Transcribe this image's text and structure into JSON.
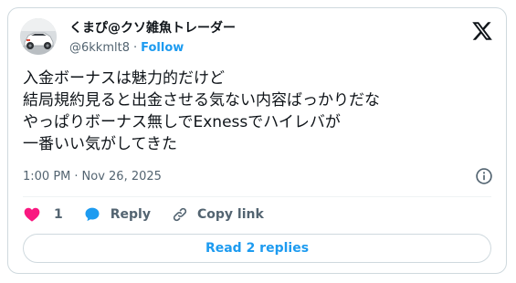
{
  "author": {
    "display_name": "くまぴ@クソ雑魚トレーダー",
    "handle": "@6kkmlt8",
    "separator": "·",
    "follow_label": "Follow",
    "avatar_icon": "white-car-photo"
  },
  "tweet": {
    "lines": [
      "入金ボーナスは魅力的だけど",
      "結局規約見ると出金させる気ない内容ばっかりだな",
      "やっぱりボーナス無しでExnessでハイレバが",
      "一番いい気がしてきた"
    ],
    "time": "1:00 PM",
    "separator": "·",
    "date": "Nov 26, 2025"
  },
  "actions": {
    "like_count": "1",
    "reply_label": "Reply",
    "copy_link_label": "Copy link"
  },
  "replies_button_label": "Read 2 replies",
  "icons": {
    "brand": "x-logo-icon",
    "info": "info-icon",
    "like": "heart-icon",
    "reply": "speech-bubble-icon",
    "copy_link": "link-icon"
  },
  "colors": {
    "accent": "#1d9bf0",
    "like": "#f91880",
    "text_primary": "#0f1419",
    "text_secondary": "#536471",
    "border": "#cfd9de"
  }
}
